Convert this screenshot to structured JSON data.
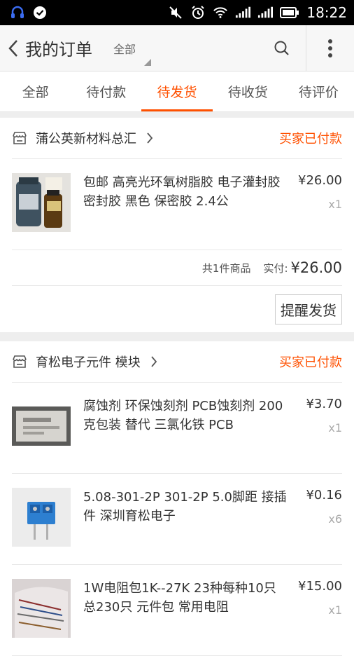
{
  "status_bar": {
    "time": "18:22"
  },
  "header": {
    "title": "我的订单",
    "filter": "全部"
  },
  "tabs": [
    {
      "label": "全部"
    },
    {
      "label": "待付款"
    },
    {
      "label": "待发货"
    },
    {
      "label": "待收货"
    },
    {
      "label": "待评价"
    }
  ],
  "active_tab": "待发货",
  "accent_color": "#ff5000",
  "orders": [
    {
      "shop_name": "蒲公英新材料总汇",
      "status": "买家已付款",
      "items": [
        {
          "title": "包邮 高亮光环氧树脂胶 电子灌封胶 密封胶 黑色 保密胶 2.4公",
          "price": "¥26.00",
          "qty": "x1"
        }
      ],
      "summary": {
        "count": "共1件商品",
        "paid_label": "实付:",
        "total": "¥26.00"
      },
      "action": "提醒发货"
    },
    {
      "shop_name": "育松电子元件 模块",
      "status": "买家已付款",
      "items": [
        {
          "title": "腐蚀剂 环保蚀刻剂 PCB蚀刻剂 200克包装 替代 三氯化铁 PCB",
          "price": "¥3.70",
          "qty": "x1"
        },
        {
          "title": "5.08-301-2P 301-2P 5.0脚距 接插件 深圳育松电子",
          "price": "¥0.16",
          "qty": "x6"
        },
        {
          "title": "1W电阻包1K--27K 23种每种10只总230只 元件包 常用电阻",
          "price": "¥15.00",
          "qty": "x1"
        }
      ]
    }
  ]
}
